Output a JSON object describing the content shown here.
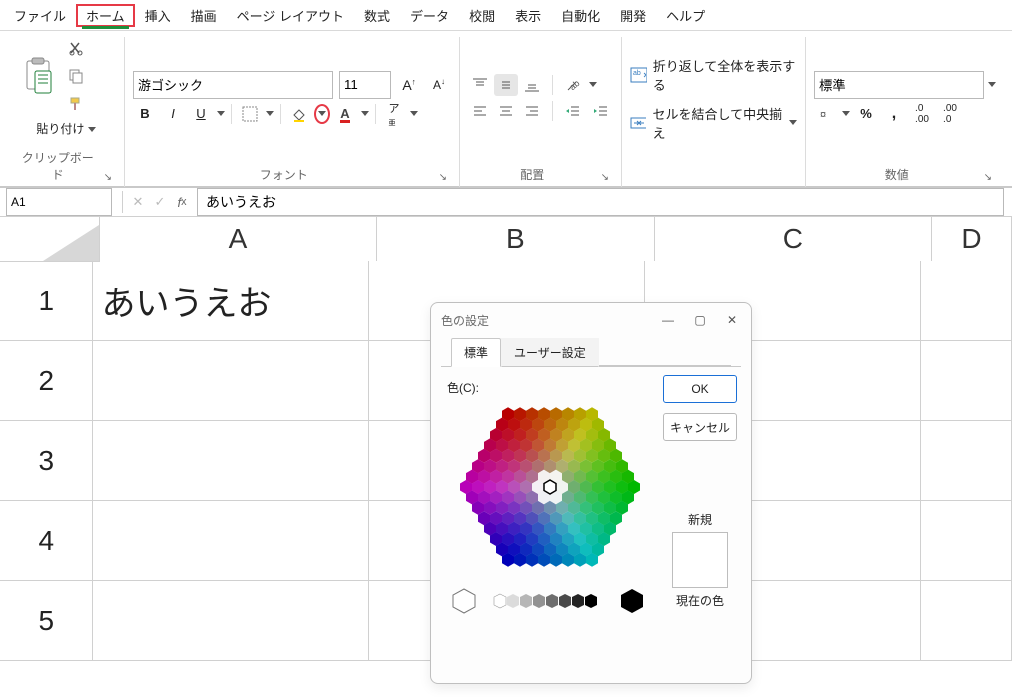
{
  "menu": {
    "items": [
      "ファイル",
      "ホーム",
      "挿入",
      "描画",
      "ページ レイアウト",
      "数式",
      "データ",
      "校閲",
      "表示",
      "自動化",
      "開発",
      "ヘルプ"
    ],
    "active_index": 1
  },
  "ribbon": {
    "clipboard": {
      "paste_label": "貼り付け",
      "group_label": "クリップボード"
    },
    "font": {
      "font_name": "游ゴシック",
      "font_size": "11",
      "group_label": "フォント"
    },
    "alignment": {
      "wrap_label": "折り返して全体を表示する",
      "merge_label": "セルを結合して中央揃え",
      "group_label": "配置"
    },
    "number": {
      "format": "標準",
      "group_label": "数値"
    }
  },
  "namebox": {
    "cell_ref": "A1"
  },
  "formula_bar": {
    "value": "あいうえお"
  },
  "sheet": {
    "columns": [
      "A",
      "B",
      "C",
      "D"
    ],
    "rows": [
      "1",
      "2",
      "3",
      "4",
      "5"
    ],
    "cells": {
      "A1": "あいうえお"
    }
  },
  "dialog": {
    "title": "色の設定",
    "tabs": [
      "標準",
      "ユーザー設定"
    ],
    "active_tab": 0,
    "color_label": "色(C):",
    "ok": "OK",
    "cancel": "キャンセル",
    "new_label": "新規",
    "current_label": "現在の色",
    "selected_color": "#ffffff"
  }
}
